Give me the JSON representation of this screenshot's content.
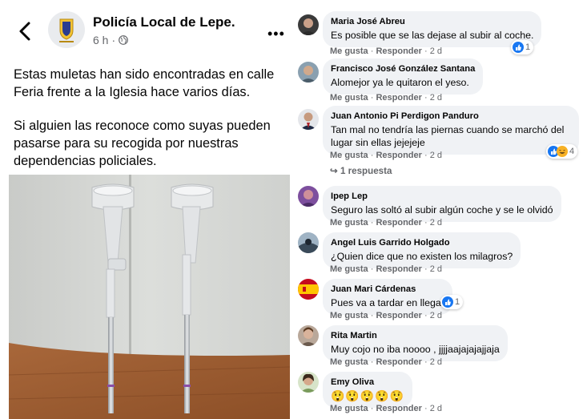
{
  "post": {
    "page_name": "Policía Local de Lepe.",
    "time": "6 h",
    "separator": "·",
    "paragraphs": [
      "Estas muletas han sido encontradas en calle Feria frente a la Iglesia hace varios días.",
      "Si alguien las reconoce como suyas pueden pasarse para su recogida por nuestras dependencias policiales."
    ],
    "more_label": "•••"
  },
  "comments": [
    {
      "name": "Maria José Abreu",
      "text": "Es posible que se las dejase al subir al coche.",
      "like": "Me gusta",
      "reply": "Responder",
      "time": "2 d",
      "reaction_count": "1"
    },
    {
      "name": "Francisco José González Santana",
      "text": "Alomejor ya le quitaron el yeso.",
      "like": "Me gusta",
      "reply": "Responder",
      "time": "2 d"
    },
    {
      "name": "Juan Antonio Pi Perdigon Panduro",
      "text": "Tan mal no tendría las piernas cuando se marchó del lugar sin ellas jejejeje",
      "like": "Me gusta",
      "reply": "Responder",
      "time": "2 d",
      "reaction_count": "4"
    },
    {
      "name": "Ipep Lep",
      "text": "Seguro las soltó al subir algún coche y se le olvidó",
      "like": "Me gusta",
      "reply": "Responder",
      "time": "2 d"
    },
    {
      "name": "Angel Luis Garrido Holgado",
      "text": "¿Quien dice que no existen los milagros?",
      "like": "Me gusta",
      "reply": "Responder",
      "time": "2 d"
    },
    {
      "name": "Juan Mari Cárdenas",
      "text": "Pues va a tardar en llegar",
      "like": "Me gusta",
      "reply": "Responder",
      "time": "2 d",
      "reaction_count": "1"
    },
    {
      "name": "Rita Martin",
      "text": "Muy cojo no iba noooo , jjjjaajajajajjaja",
      "like": "Me gusta",
      "reply": "Responder",
      "time": "2 d"
    },
    {
      "name": "Emy Oliva",
      "text": "😲😲😲😲😲",
      "like": "Me gusta",
      "reply": "Responder",
      "time": "2 d"
    }
  ],
  "replies_label": "1 respuesta",
  "colors": {
    "bubble": "#f0f2f5",
    "meta": "#65676b",
    "like_blue": "#1877f2",
    "haha_yellow": "#f7b125"
  }
}
